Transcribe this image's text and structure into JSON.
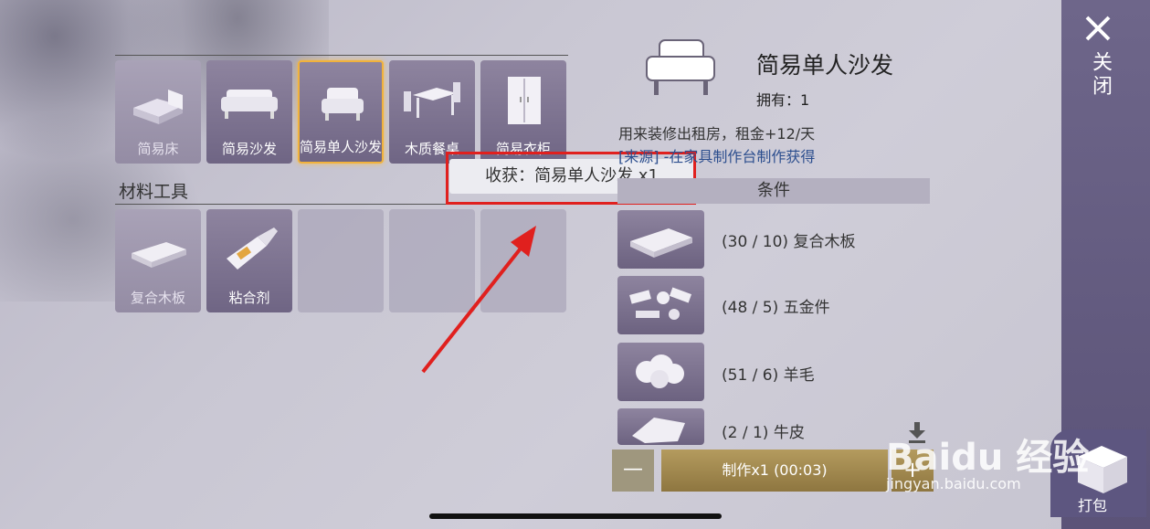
{
  "furniture_items": [
    {
      "label": "简易床",
      "state": "dim",
      "icon": "bed-icon"
    },
    {
      "label": "简易沙发",
      "state": "normal",
      "icon": "sofa-icon"
    },
    {
      "label": "简易单人沙发",
      "state": "selected",
      "icon": "armchair-icon"
    },
    {
      "label": "木质餐桌",
      "state": "normal",
      "icon": "dining-table-icon"
    },
    {
      "label": "简易衣柜",
      "state": "normal",
      "icon": "wardrobe-icon"
    }
  ],
  "materials_section": {
    "title": "材料工具",
    "items": [
      {
        "label": "复合木板",
        "state": "dim",
        "icon": "wood-planks-icon"
      },
      {
        "label": "粘合剂",
        "state": "normal",
        "icon": "glue-bottle-icon"
      },
      {
        "label": "",
        "state": "empty"
      },
      {
        "label": "",
        "state": "empty"
      },
      {
        "label": "",
        "state": "empty"
      }
    ]
  },
  "tooltip": {
    "text": "收获：简易单人沙发 x1"
  },
  "detail": {
    "title": "简易单人沙发",
    "owned": "拥有：1",
    "description": "用来装修出租房，租金+12/天",
    "source": "[来源] -在家具制作台制作获得",
    "conditions_header": "条件",
    "conditions": [
      {
        "text": "(30 / 10) 复合木板",
        "icon": "wood-planks-icon"
      },
      {
        "text": "(48 / 5) 五金件",
        "icon": "hardware-icon"
      },
      {
        "text": "(51 / 6) 羊毛",
        "icon": "wool-icon"
      },
      {
        "text": "(2 / 1) 牛皮",
        "icon": "leather-icon"
      }
    ]
  },
  "controls": {
    "minus_label": "—",
    "make_label": "制作x1 (00:03)",
    "plus_label": "+"
  },
  "sidebar": {
    "close_label": "关闭",
    "pack_label": "打包"
  },
  "watermark": {
    "text": "Baidu 经验",
    "url": "jingyan.baidu.com"
  },
  "colors": {
    "accent_selected": "#f1b23c",
    "annotation_red": "#e0201e",
    "sidebar": "#6e668a"
  }
}
